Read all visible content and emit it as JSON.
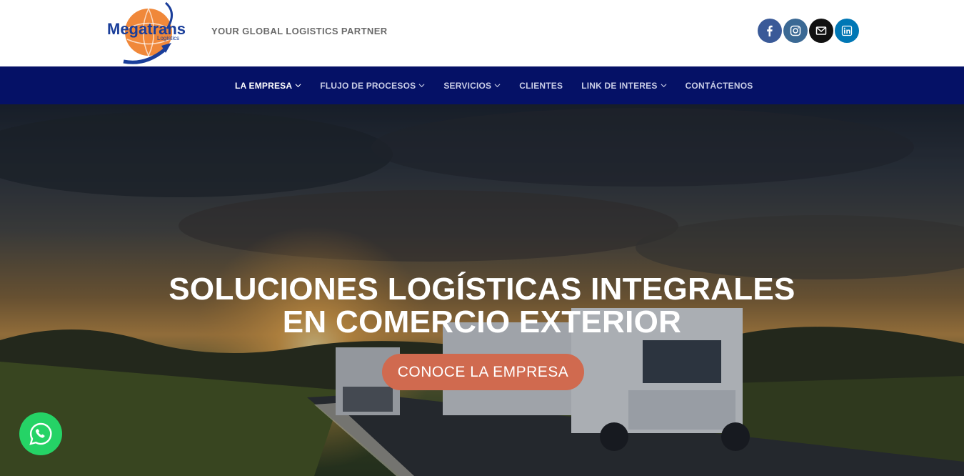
{
  "header": {
    "logo_text": "Megatrans",
    "logo_subtext": "Logistics",
    "tagline": "YOUR GLOBAL LOGISTICS PARTNER",
    "socials": [
      "facebook-icon",
      "instagram-icon",
      "mail-icon",
      "linkedin-icon"
    ]
  },
  "nav": {
    "items": [
      {
        "label": "LA EMPRESA",
        "dropdown": true
      },
      {
        "label": "FLUJO DE PROCESOS",
        "dropdown": true
      },
      {
        "label": "SERVICIOS",
        "dropdown": true
      },
      {
        "label": "CLIENTES",
        "dropdown": false
      },
      {
        "label": "LINK DE INTERES",
        "dropdown": true
      },
      {
        "label": "CONTÁCTENOS",
        "dropdown": false
      }
    ]
  },
  "hero": {
    "title_line1": "SOLUCIONES LOGÍSTICAS INTEGRALES",
    "title_line2": "EN COMERCIO EXTERIOR",
    "cta_label": "CONOCE LA EMPRESA"
  },
  "colors": {
    "nav_bg": "#051166",
    "cta_bg": "#d06a4f",
    "whatsapp": "#25d366",
    "logo_blue": "#1a3e9a",
    "logo_orange": "#f0883a"
  },
  "floating": {
    "whatsapp_icon": "whatsapp-icon"
  }
}
